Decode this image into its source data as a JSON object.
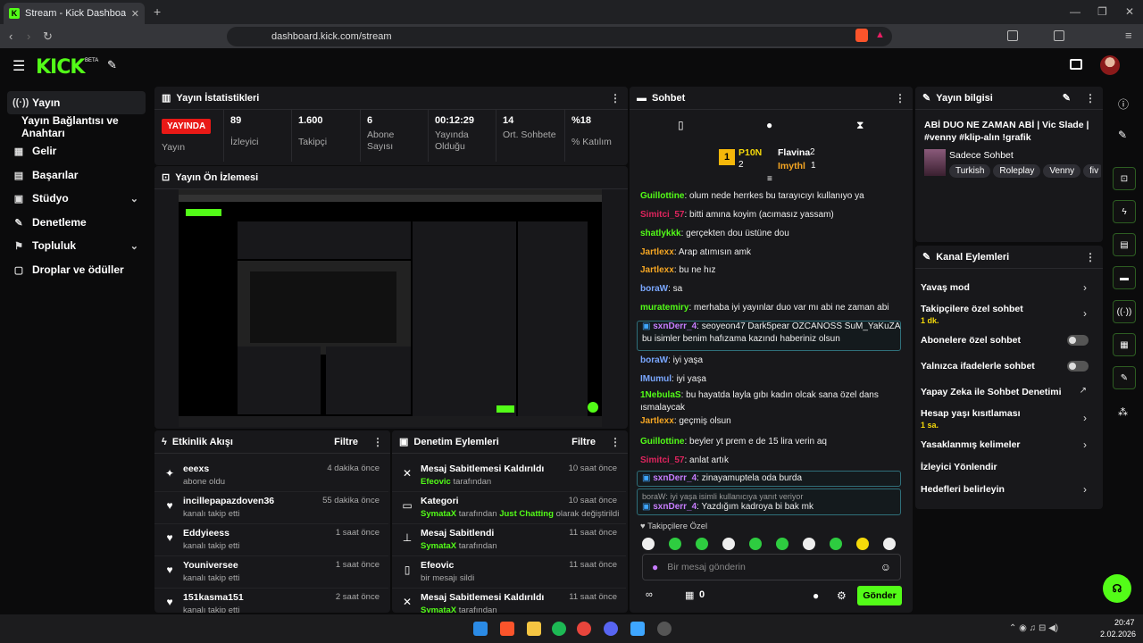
{
  "browser": {
    "tab_title": "Stream - Kick Dashboard",
    "url": "dashboard.kick.com/stream"
  },
  "app": {
    "logo": "KICK",
    "beta": "BETA"
  },
  "sidebar": {
    "items": [
      {
        "label": "Yayın",
        "icon": "broadcast-icon"
      },
      {
        "label": "Yayın Bağlantısı ve Anahtarı"
      },
      {
        "label": "Gelir",
        "icon": "revenue-icon"
      },
      {
        "label": "Başarılar",
        "icon": "trophy-icon"
      },
      {
        "label": "Stüdyo",
        "icon": "studio-icon"
      },
      {
        "label": "Denetleme",
        "icon": "wrench-icon"
      },
      {
        "label": "Topluluk",
        "icon": "community-icon"
      },
      {
        "label": "Droplar ve ödüller",
        "icon": "drops-icon"
      }
    ]
  },
  "stats": {
    "title": "Yayın İstatistikleri",
    "live_badge": "YAYINDA",
    "live_label": "Yayın",
    "items": [
      {
        "value": "89",
        "label": "İzleyici"
      },
      {
        "value": "1.600",
        "label": "Takipçi"
      },
      {
        "value": "6",
        "label": "Abone Sayısı"
      },
      {
        "value": "00:12:29",
        "label": "Yayında Olduğu"
      },
      {
        "value": "14",
        "label": "Ort. Sohbete"
      },
      {
        "value": "%18",
        "label": "% Katılım"
      }
    ]
  },
  "preview": {
    "title": "Yayın Ön İzlemesi"
  },
  "activity": {
    "title": "Etkinlik Akışı",
    "filter": "Filtre",
    "items": [
      {
        "name": "eeexs",
        "sub": "abone oldu",
        "time": "4 dakika önce",
        "icon": "star-icon"
      },
      {
        "name": "incillepapazdoven36",
        "sub": "kanalı takip etti",
        "time": "55 dakika önce",
        "icon": "heart-icon"
      },
      {
        "name": "Eddyieess",
        "sub": "kanalı takip etti",
        "time": "1 saat önce",
        "icon": "heart-icon"
      },
      {
        "name": "Youniversee",
        "sub": "kanalı takip etti",
        "time": "1 saat önce",
        "icon": "heart-icon"
      },
      {
        "name": "151kasma151",
        "sub": "kanalı takip etti",
        "time": "2 saat önce",
        "icon": "heart-icon"
      }
    ]
  },
  "moderation": {
    "title": "Denetim Eylemleri",
    "filter": "Filtre",
    "items": [
      {
        "name": "Mesaj Sabitlemesi Kaldırıldı",
        "user": "Efeovic",
        "sub": "tarafından",
        "time": "10 saat önce"
      },
      {
        "name": "Kategori",
        "user": "SymataX",
        "sub": "tarafından",
        "extra": "Just Chatting",
        "extra2": "olarak değiştirildi",
        "time": "10 saat önce"
      },
      {
        "name": "Mesaj Sabitlendi",
        "user": "SymataX",
        "sub": "tarafından",
        "time": "11 saat önce"
      },
      {
        "name": "Efeovic",
        "user": "",
        "sub": "bir mesajı sildi",
        "time": "11 saat önce"
      },
      {
        "name": "Mesaj Sabitlemesi Kaldırıldı",
        "user": "SymataX",
        "sub": "tarafından",
        "time": "11 saat önce"
      }
    ]
  },
  "chat": {
    "title": "Sohbet",
    "leaders": {
      "first": "P10N",
      "first_count": "1",
      "second": "Flavina",
      "second_count": "2",
      "third": "Imythl",
      "third_count": "1",
      "rank2": "2",
      "rank1": "1"
    },
    "messages": [
      {
        "user": "Guillottine",
        "color": "#53fc18",
        "text": "olum nede herrkes bu tarayıcıyı kullanıyo ya"
      },
      {
        "user": "Simitci_57",
        "color": "#e0245e",
        "text": "bitti amına koyim (acımasız yassam)"
      },
      {
        "user": "shatlykkk",
        "color": "#53fc18",
        "text": "gerçekten dou üstüne dou"
      },
      {
        "user": "Jartlexx",
        "color": "#f5a623",
        "text": "Arap atımısın amk"
      },
      {
        "user": "Jartlexx",
        "color": "#f5a623",
        "text": "bu ne hız"
      },
      {
        "user": "boraW",
        "color": "#7aa7ff",
        "text": "sa"
      },
      {
        "user": "muratemiry",
        "color": "#53fc18",
        "text": "merhaba iyi yayınlar duo var mı abi ne zaman abi"
      },
      {
        "user": "sxnDerr_4",
        "color": "#c77dff",
        "text": "seoyeon47 Dark5pear OZCANOSS SuM_YaKuZA bu isimler benim hafızama kazındı haberiniz olsun"
      },
      {
        "user": "boraW",
        "color": "#7aa7ff",
        "text": "iyi yaşa"
      },
      {
        "user": "IMumul",
        "color": "#7aa7ff",
        "text": "iyi yaşa"
      },
      {
        "user": "1NebulaS",
        "color": "#53fc18",
        "text": "bu hayatda layla gıbı kadın olcak sana özel dans ısmalaycak"
      },
      {
        "user": "Jartlexx",
        "color": "#f5a623",
        "text": "geçmiş olsun"
      },
      {
        "user": "Guillottine",
        "color": "#53fc18",
        "text": "beyler yt prem e de 15 lira verin aq"
      },
      {
        "user": "Simitci_57",
        "color": "#e0245e",
        "text": "anlat artık"
      },
      {
        "user": "sxnDerr_4",
        "color": "#c77dff",
        "text": "zinayamuptela oda burda"
      },
      {
        "user": "sxnDerr_4",
        "color": "#c77dff",
        "text": "Yazdığım kadroya bi bak mk"
      }
    ],
    "reply_note": "boraW: iyi yaşa isimli kullanıcıya yanıt veriyor",
    "followers_only": "Takipçilere Özel",
    "placeholder": "Bir mesaj gönderin",
    "points": "0",
    "send": "Gönder"
  },
  "info": {
    "title": "Yayın bilgisi",
    "stream_title": "ABİ DUO NE ZAMAN ABİ | Vic Slade | #venny #klip-alın !grafik",
    "category": "Sadece Sohbet",
    "tags": [
      "Turkish",
      "Roleplay",
      "Venny",
      "fiv"
    ]
  },
  "channel": {
    "title": "Kanal Eylemleri",
    "actions": [
      {
        "label": "Yavaş mod",
        "type": "chevron"
      },
      {
        "label": "Takipçilere özel sohbet",
        "sub": "1 dk.",
        "type": "chevron"
      },
      {
        "label": "Abonelere özel sohbet",
        "type": "toggle"
      },
      {
        "label": "Yalnızca ifadelerle sohbet",
        "type": "toggle"
      },
      {
        "label": "Yapay Zeka ile Sohbet Denetimi",
        "type": "external"
      },
      {
        "label": "Hesap yaşı kısıtlaması",
        "sub": "1 sa.",
        "type": "chevron"
      },
      {
        "label": "Yasaklanmış kelimeler",
        "type": "chevron"
      },
      {
        "label": "İzleyici Yönlendir",
        "type": "none"
      },
      {
        "label": "Hedefleri belirleyin",
        "type": "chevron"
      }
    ]
  },
  "clock": {
    "time": "20:47",
    "date": "2.02.2026"
  },
  "colors": {
    "accent": "#53fc18",
    "live": "#e91916",
    "panel": "#18181b",
    "bg": "#0b0b0c"
  }
}
